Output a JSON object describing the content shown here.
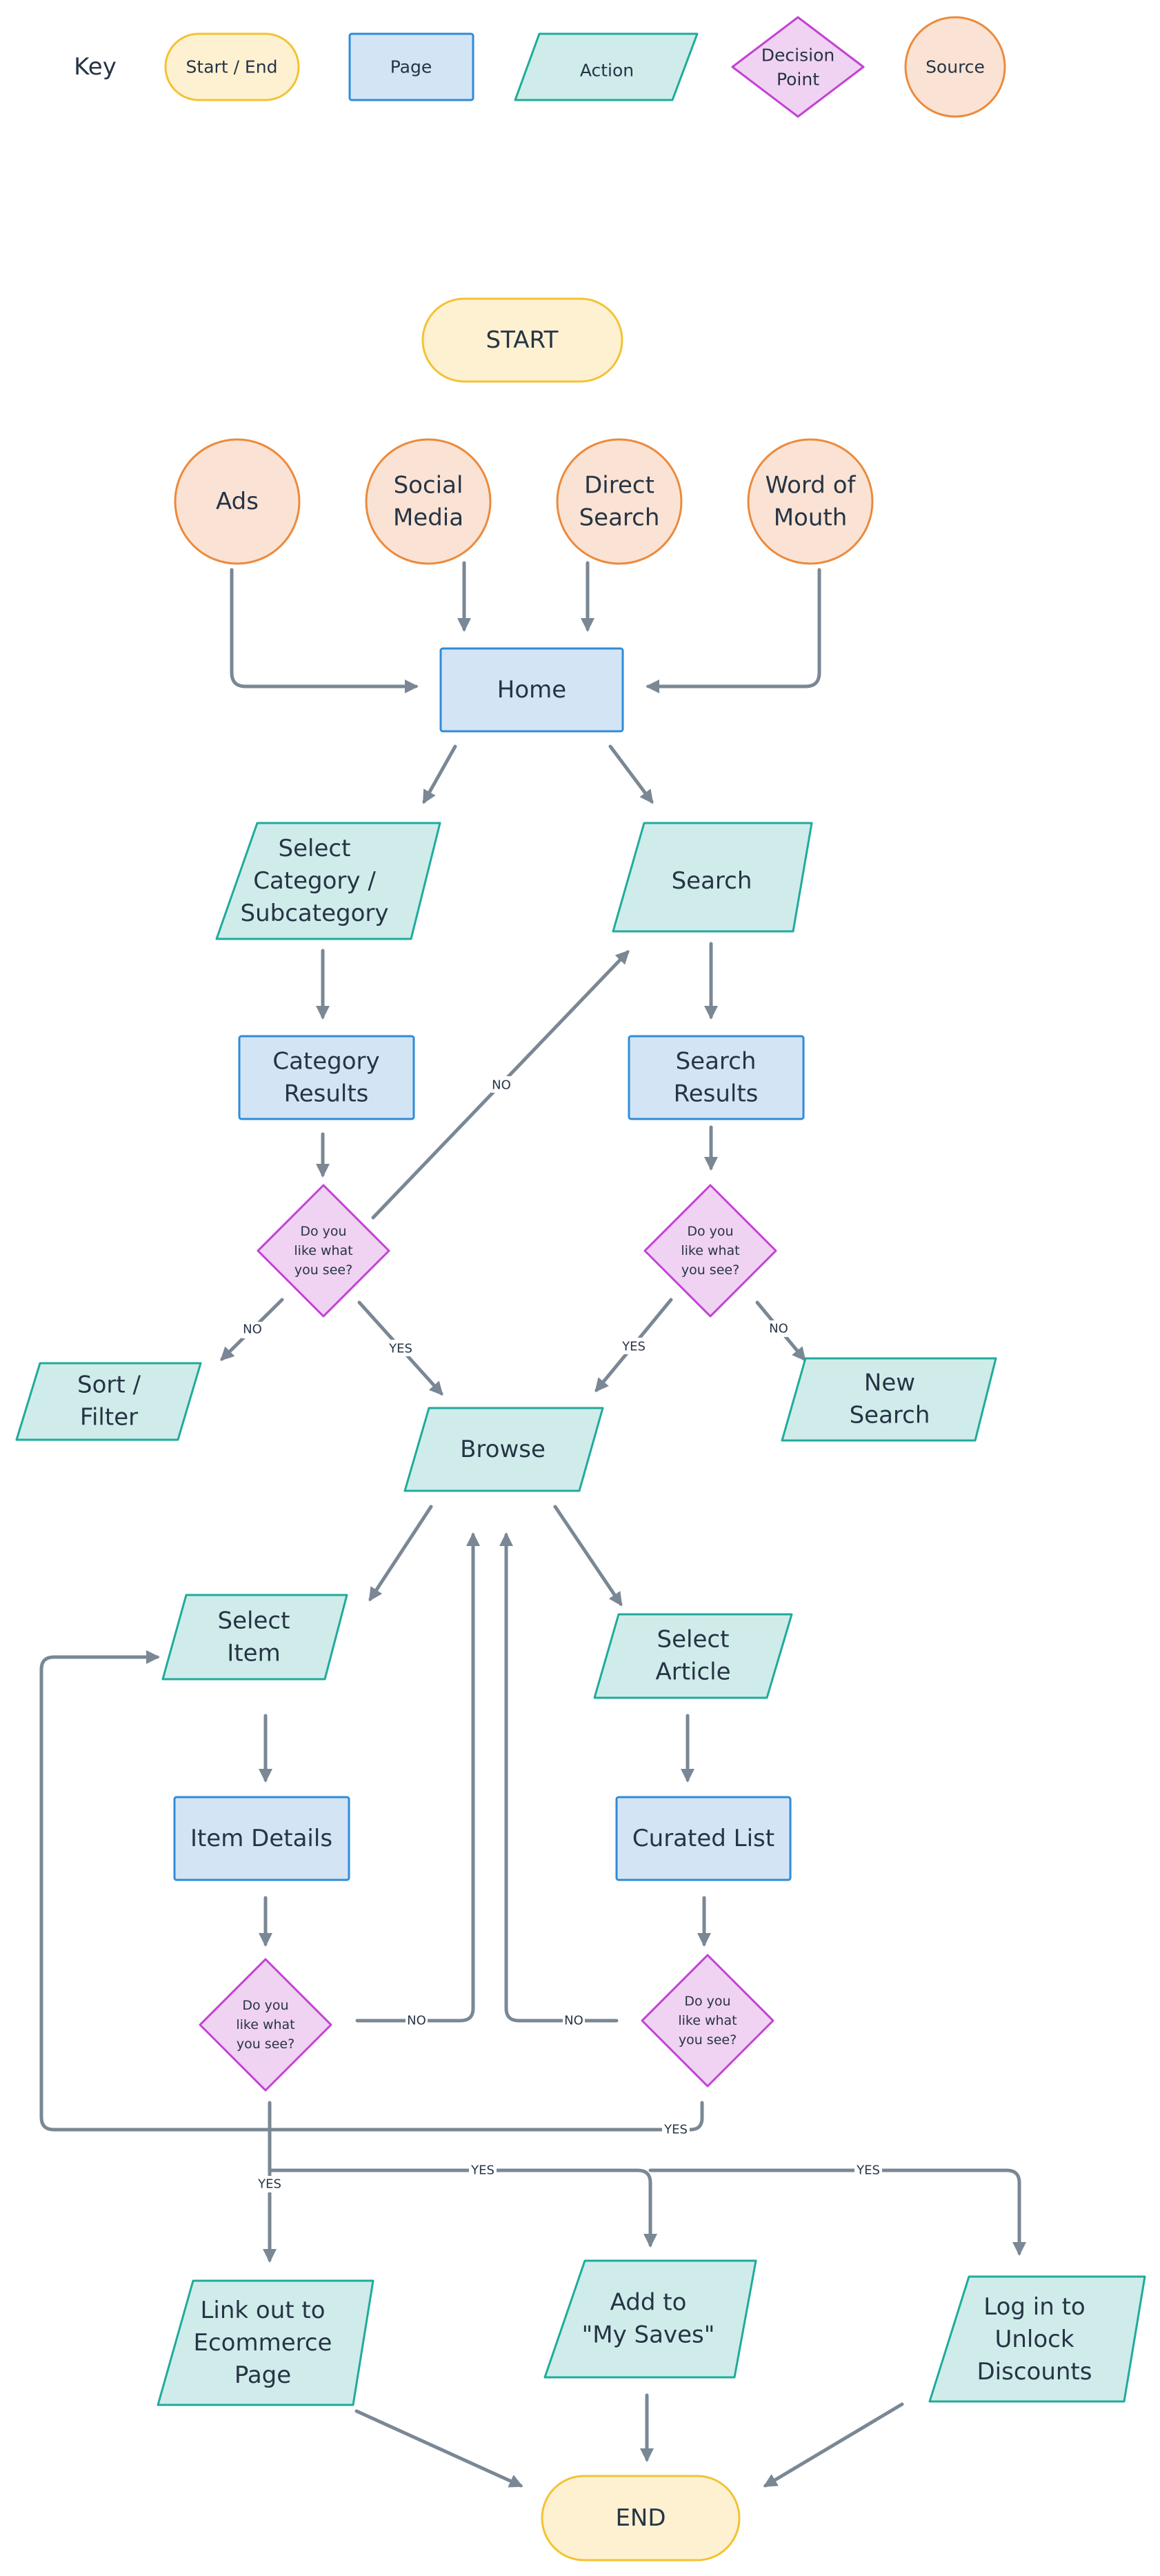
{
  "key": {
    "title": "Key",
    "items": [
      {
        "type": "startend",
        "label": "Start / End"
      },
      {
        "type": "page",
        "label": "Page"
      },
      {
        "type": "action",
        "label": "Action"
      },
      {
        "type": "decision",
        "label": [
          "Decision",
          "Point"
        ]
      },
      {
        "type": "source",
        "label": "Source"
      }
    ]
  },
  "colors": {
    "startend_fill": "#fdf1d2",
    "startend_stroke": "#f4c232",
    "page_fill": "#d3e5f5",
    "page_stroke": "#2f8bd8",
    "action_fill": "#cfecea",
    "action_stroke": "#1fab9b",
    "decision_fill": "#f0d2f3",
    "decision_stroke": "#c342d4",
    "source_fill": "#fae3d4",
    "source_stroke": "#ec8a3c",
    "edge": "#7a8794",
    "text": "#263445"
  },
  "nodes": {
    "start": {
      "label": [
        "START"
      ]
    },
    "ads": {
      "label": [
        "Ads"
      ]
    },
    "social": {
      "label": [
        "Social",
        "Media"
      ]
    },
    "direct": {
      "label": [
        "Direct",
        "Search"
      ]
    },
    "wom": {
      "label": [
        "Word of",
        "Mouth"
      ]
    },
    "home": {
      "label": [
        "Home"
      ]
    },
    "select_cat": {
      "label": [
        "Select",
        "Category /",
        "Subcategory"
      ]
    },
    "search": {
      "label": [
        "Search"
      ]
    },
    "cat_results": {
      "label": [
        "Category",
        "Results"
      ]
    },
    "search_results": {
      "label": [
        "Search",
        "Results"
      ]
    },
    "dec_cat": {
      "label": [
        "Do you",
        "like what",
        "you see?"
      ]
    },
    "dec_search": {
      "label": [
        "Do you",
        "like what",
        "you see?"
      ]
    },
    "sort_filter": {
      "label": [
        "Sort /",
        "Filter"
      ]
    },
    "new_search": {
      "label": [
        "New",
        "Search"
      ]
    },
    "browse": {
      "label": [
        "Browse"
      ]
    },
    "select_item": {
      "label": [
        "Select",
        "Item"
      ]
    },
    "select_article": {
      "label": [
        "Select",
        "Article"
      ]
    },
    "item_details": {
      "label": [
        "Item Details"
      ]
    },
    "curated_list": {
      "label": [
        "Curated List"
      ]
    },
    "dec_item": {
      "label": [
        "Do you",
        "like what",
        "you see?"
      ]
    },
    "dec_article": {
      "label": [
        "Do you",
        "like what",
        "you see?"
      ]
    },
    "link_out": {
      "label": [
        "Link out to",
        "Ecommerce",
        "Page"
      ]
    },
    "add_saves": {
      "label": [
        "Add to",
        "\"My Saves\""
      ]
    },
    "login": {
      "label": [
        "Log in to",
        "Unlock",
        "Discounts"
      ]
    },
    "end": {
      "label": [
        "END"
      ]
    }
  },
  "edge_labels": {
    "cat_no": "NO",
    "cat_yes": "YES",
    "cat_no_search": "NO",
    "search_yes": "YES",
    "search_no": "NO",
    "item_no": "NO",
    "article_no": "NO",
    "article_yes": "YES",
    "item_yes_down": "YES",
    "item_yes_saves": "YES",
    "item_yes_login": "YES"
  }
}
